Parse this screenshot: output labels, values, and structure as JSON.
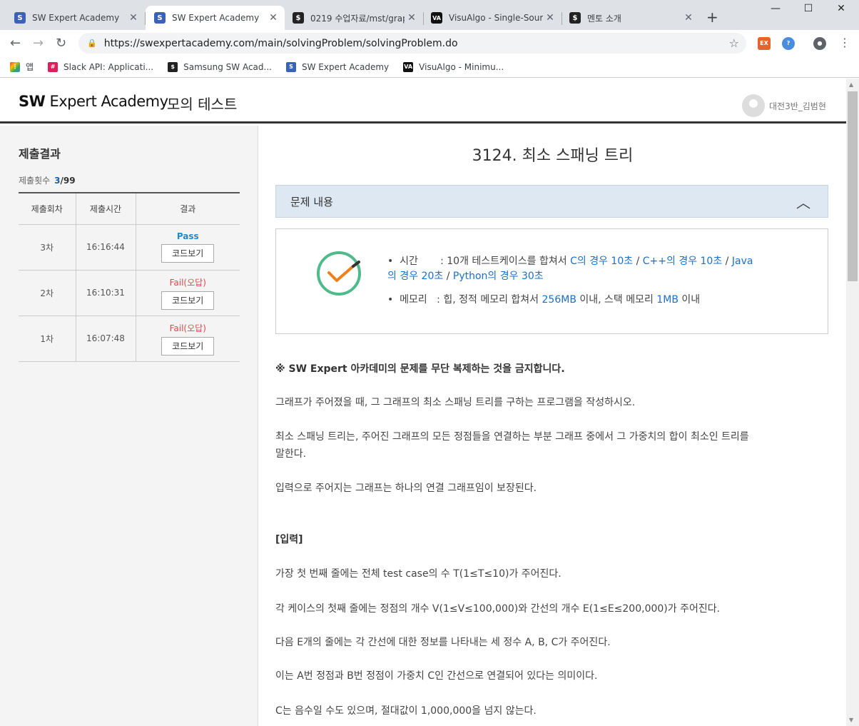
{
  "browser": {
    "tabs": [
      {
        "title": "SW Expert Academy",
        "icon": "sw-logo-icon"
      },
      {
        "title": "SW Expert Academy",
        "icon": "sw-logo-icon",
        "active": true
      },
      {
        "title": "0219 수업자료/mst/grap",
        "icon": "notion-icon"
      },
      {
        "title": "VisuAlgo - Single-Sourc",
        "icon": "visualgo-icon"
      },
      {
        "title": "멘토 소개",
        "icon": "notion-icon"
      }
    ],
    "url": "https://swexpertacademy.com/main/solvingProblem/solvingProblem.do",
    "bookmarks": [
      {
        "label": "앱",
        "icon": "apps-grid-icon"
      },
      {
        "label": "Slack API: Applicati...",
        "icon": "slack-icon"
      },
      {
        "label": "Samsung SW Acad...",
        "icon": "notion-icon"
      },
      {
        "label": "SW Expert Academy",
        "icon": "sw-logo-icon"
      },
      {
        "label": "VisuAlgo - Minimu...",
        "icon": "visualgo-icon"
      }
    ]
  },
  "header": {
    "logo_bold": "SW",
    "logo_rest": "Expert Academy",
    "mode": "모의 테스트",
    "user": "대전3반_김범현"
  },
  "sidebar": {
    "title": "제출결과",
    "count_label": "제출횟수",
    "count": "3",
    "total": "/99",
    "columns": [
      "제출회차",
      "제출시간",
      "결과"
    ],
    "rows": [
      {
        "round": "3차",
        "time": "16:16:44",
        "result": "Pass",
        "button": "코드보기"
      },
      {
        "round": "2차",
        "time": "16:10:31",
        "result": "Fail(오답)",
        "button": "코드보기"
      },
      {
        "round": "1차",
        "time": "16:07:48",
        "result": "Fail(오답)",
        "button": "코드보기"
      }
    ]
  },
  "problem": {
    "title": "3124. 최소 스패닝 트리",
    "section": "문제 내용",
    "time_label": "시간",
    "time_text": ": 10개 테스트케이스를 합쳐서 ",
    "time_c": "C의 경우 10초",
    "time_cpp": "C++의 경우 10초",
    "time_java": "Java",
    "time_java2": "의 경우 20초",
    "time_python": "Python의 경우 30초",
    "mem_label": "메모리",
    "mem_text1": ": 힙, 정적 메모리 합쳐서 ",
    "mem_heap": "256MB",
    "mem_text2": " 이내, 스택 메모리 ",
    "mem_stack": "1MB",
    "mem_text3": " 이내",
    "notice": "※ SW Expert 아카데미의 문제를 무단 복제하는 것을 금지합니다.",
    "paragraphs": [
      "그래프가 주어졌을 때, 그 그래프의 최소 스패닝 트리를 구하는 프로그램을 작성하시오.",
      "최소 스패닝 트리는, 주어진 그래프의 모든 정점들을 연결하는 부분 그래프 중에서 그 가중치의 합이 최소인 트리를",
      "말한다.",
      "입력으로 주어지는 그래프는 하나의 연결 그래프임이 보장된다."
    ],
    "input_heading": "[입력]",
    "input_lines": [
      "가장 첫 번째 줄에는 전체 test case의 수 T(1≤T≤10)가 주어진다.",
      "각 케이스의 첫째 줄에는 정점의 개수 V(1≤V≤100,000)와 간선의 개수 E(1≤E≤200,000)가 주어진다.",
      "다음 E개의 줄에는 각 간선에 대한 정보를 나타내는 세 정수 A, B, C가 주어진다.",
      "이는 A번 정점과 B번 정점이 가중치 C인 간선으로 연결되어 있다는 의미이다.",
      "C는 음수일 수도 있으며, 절대값이 1,000,000을 넘지 않는다."
    ]
  }
}
